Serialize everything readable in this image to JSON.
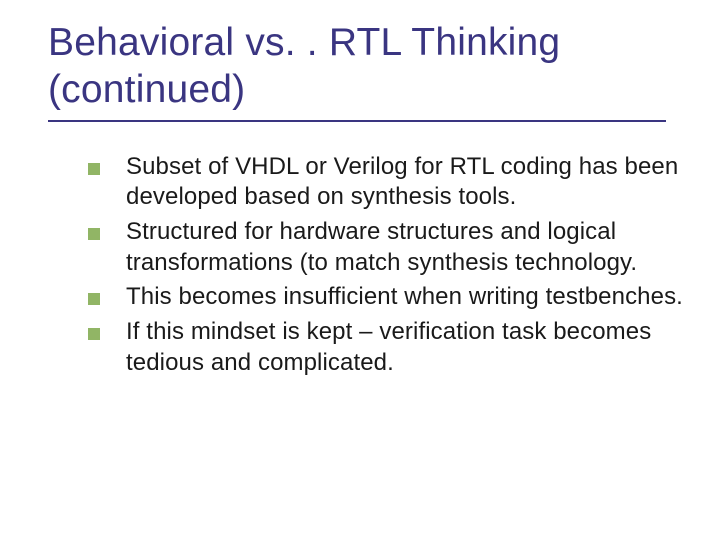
{
  "slide": {
    "title_line1": "Behavioral vs. . RTL Thinking",
    "title_line2": "(continued)",
    "bullets": [
      "Subset of VHDL or Verilog for RTL coding has been developed based on synthesis tools.",
      "Structured for hardware structures and logical transformations (to match synthesis technology.",
      "This becomes insufficient when writing testbenches.",
      "If this mindset is kept – verification task becomes tedious and complicated."
    ]
  }
}
